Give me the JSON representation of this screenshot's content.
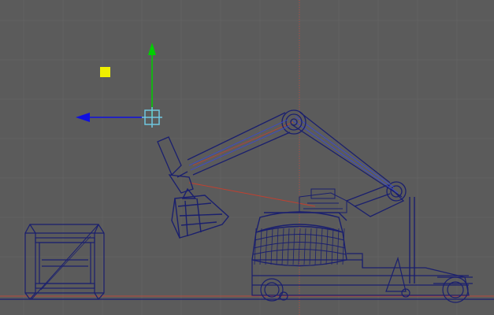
{
  "viewport": {
    "view": "side",
    "background_color": "#5b5b5b",
    "grid_color": "#6a6a6a",
    "origin_axis_color": "#c05040",
    "wireframe_color": "#1a1f6e",
    "wireframe_highlight_color": "#3a4ad0",
    "ik_handle_color": "#d04030",
    "selected_color": "#70c8e0",
    "light_color": "#f0f000"
  },
  "manipulator": {
    "type": "move-tool",
    "y_axis_color": "#00d000",
    "z_axis_color": "#1010e0",
    "center_color": "#70c8e0"
  },
  "scene_objects": [
    {
      "name": "crate",
      "type": "mesh",
      "selected": false
    },
    {
      "name": "robot-base",
      "type": "mesh",
      "selected": false
    },
    {
      "name": "robot-arm",
      "type": "mesh",
      "selected": false
    },
    {
      "name": "robot-claw",
      "type": "mesh",
      "selected": false
    },
    {
      "name": "robot-cart",
      "type": "mesh",
      "selected": false
    },
    {
      "name": "light",
      "type": "light",
      "icon": "square-light-icon"
    },
    {
      "name": "ik-handle",
      "type": "ik-handle",
      "selected": true
    }
  ]
}
